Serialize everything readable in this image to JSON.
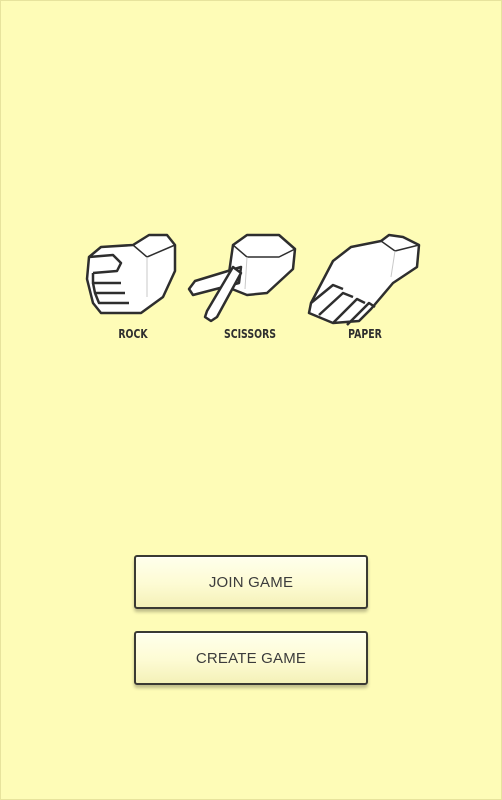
{
  "logo": {
    "hands": [
      {
        "name": "rock-hand-icon",
        "label": "ROCK"
      },
      {
        "name": "scissors-hand-icon",
        "label": "SCISSORS"
      },
      {
        "name": "paper-hand-icon",
        "label": "PAPER"
      }
    ]
  },
  "buttons": {
    "join_label": "JOIN GAME",
    "create_label": "CREATE GAME"
  },
  "colors": {
    "background": "#fefcb7",
    "button_border": "#3a3a33",
    "text": "#3c3c3c"
  }
}
